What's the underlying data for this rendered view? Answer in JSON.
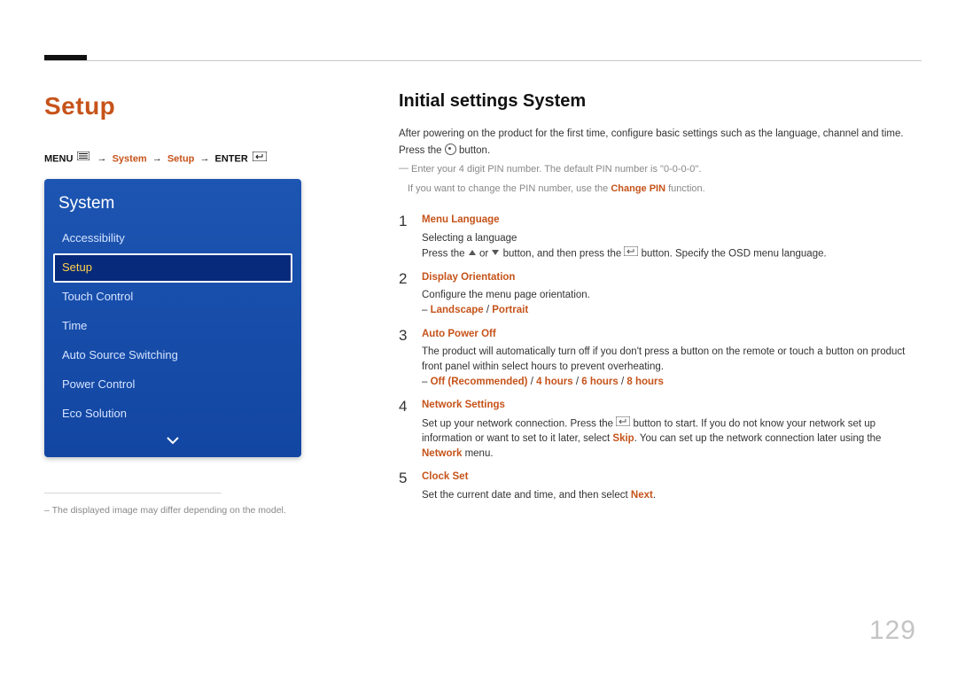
{
  "page_number": "129",
  "left": {
    "title": "Setup",
    "breadcrumb": {
      "menu": "MENU",
      "arrow": "→",
      "parts": [
        "System",
        "Setup"
      ],
      "enter": "ENTER"
    },
    "panel_title": "System",
    "menu_items": [
      {
        "label": "Accessibility",
        "selected": false
      },
      {
        "label": "Setup",
        "selected": true
      },
      {
        "label": "Touch Control",
        "selected": false
      },
      {
        "label": "Time",
        "selected": false
      },
      {
        "label": "Auto Source Switching",
        "selected": false
      },
      {
        "label": "Power Control",
        "selected": false
      },
      {
        "label": "Eco Solution",
        "selected": false
      }
    ],
    "note": "The displayed image may differ depending on the model."
  },
  "right": {
    "heading": "Initial settings System",
    "intro1": "After powering on the product for the first time, configure basic settings such as the language, channel and time.",
    "intro2_a": "Press the ",
    "intro2_b": " button.",
    "note_line1": "Enter your 4 digit PIN number. The default PIN number is \"0-0-0-0\".",
    "note_line2_a": "If you want to change the PIN number, use the ",
    "note_line2_b": "Change PIN",
    "note_line2_c": " function.",
    "steps": [
      {
        "num": "1",
        "title": "Menu Language",
        "body1": "Selecting a language",
        "body2_a": "Press the ",
        "body2_b": " or ",
        "body2_c": " button, and then press the ",
        "body2_d": " button. Specify the OSD menu language."
      },
      {
        "num": "2",
        "title": "Display Orientation",
        "body1": "Configure the menu page orientation.",
        "opts_a": "Landscape",
        "opts_sep": " / ",
        "opts_b": "Portrait"
      },
      {
        "num": "3",
        "title": "Auto Power Off",
        "body1": "The product will automatically turn off if you don't press a button on the remote or touch a button on product front panel within select hours to prevent overheating.",
        "opts_a": "Off (Recommended)",
        "opts_b": "4 hours",
        "opts_c": "6 hours",
        "opts_d": "8 hours",
        "sep": " / "
      },
      {
        "num": "4",
        "title": "Network Settings",
        "body_a": "Set up your network connection. Press the ",
        "body_b": " button to start. If you do not know your network set up information or want to set to it later, select ",
        "body_skip": "Skip",
        "body_c": ". You can set up the network connection later using the ",
        "body_net": "Network",
        "body_d": " menu."
      },
      {
        "num": "5",
        "title": "Clock Set",
        "body_a": "Set the current date and time, and then select ",
        "body_next": "Next",
        "body_b": "."
      }
    ]
  }
}
